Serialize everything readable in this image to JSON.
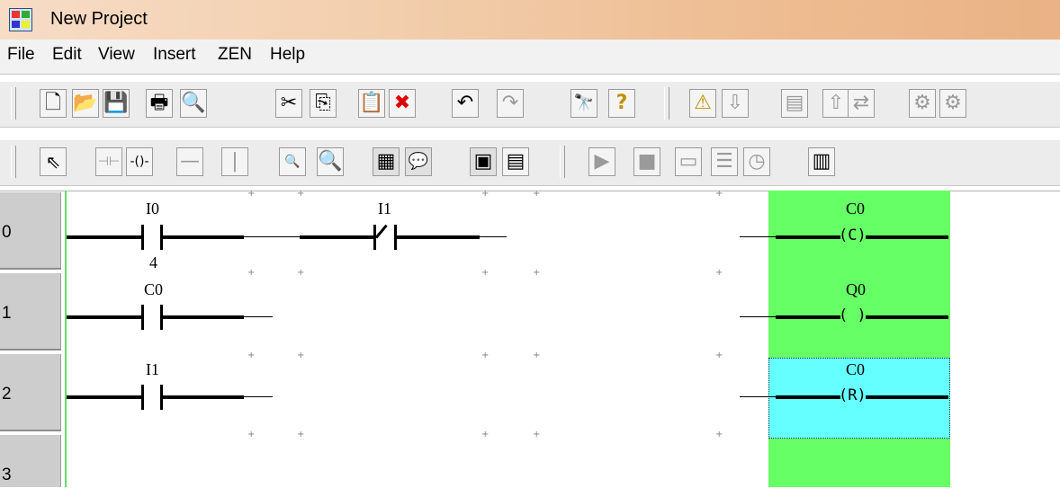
{
  "window": {
    "title": "New Project"
  },
  "menu": {
    "items": [
      "File",
      "Edit",
      "View",
      "Insert",
      "ZEN",
      "Help"
    ]
  },
  "toolbar1": {
    "buttons": [
      {
        "name": "new-file-icon",
        "glyph": "🗋"
      },
      {
        "name": "open-folder-icon",
        "glyph": "📂"
      },
      {
        "name": "save-icon",
        "glyph": "💾"
      },
      {
        "name": "print-icon",
        "glyph": "🖶"
      },
      {
        "name": "print-preview-icon",
        "glyph": "🔍"
      },
      {
        "name": "cut-icon",
        "glyph": "✂"
      },
      {
        "name": "copy-icon",
        "glyph": "⎘"
      },
      {
        "name": "paste-icon",
        "glyph": "📋"
      },
      {
        "name": "delete-icon",
        "glyph": "✖"
      },
      {
        "name": "undo-icon",
        "glyph": "↶"
      },
      {
        "name": "redo-icon",
        "glyph": "↷"
      },
      {
        "name": "find-icon",
        "glyph": "🔭"
      },
      {
        "name": "help-icon",
        "glyph": "?"
      },
      {
        "name": "warning-icon",
        "glyph": "⚠"
      },
      {
        "name": "transfer-icon",
        "glyph": "⇩"
      },
      {
        "name": "program-icon",
        "glyph": "▤"
      },
      {
        "name": "upload-icon",
        "glyph": "⇧"
      },
      {
        "name": "compare-icon",
        "glyph": "⇄"
      },
      {
        "name": "connect-icon",
        "glyph": "⚙"
      },
      {
        "name": "disconnect-icon",
        "glyph": "⚙"
      }
    ]
  },
  "toolbar2": {
    "buttons": [
      {
        "name": "select-pointer-icon",
        "glyph": "⇖"
      },
      {
        "name": "contact-icon",
        "glyph": "⊣⊢"
      },
      {
        "name": "coil-icon",
        "glyph": "-()-"
      },
      {
        "name": "horizontal-line-icon",
        "glyph": "—"
      },
      {
        "name": "vertical-line-icon",
        "glyph": "|"
      },
      {
        "name": "zoom-out-icon",
        "glyph": "🔍"
      },
      {
        "name": "zoom-in-icon",
        "glyph": "🔍"
      },
      {
        "name": "grid-icon",
        "glyph": "▦"
      },
      {
        "name": "comment-icon",
        "glyph": "💬"
      },
      {
        "name": "ladder-view-icon",
        "glyph": "▣"
      },
      {
        "name": "mnemonic-view-icon",
        "glyph": "▤"
      },
      {
        "name": "run-icon",
        "glyph": "▶"
      },
      {
        "name": "stop-icon",
        "glyph": "■"
      },
      {
        "name": "monitor-icon",
        "glyph": "▭"
      },
      {
        "name": "list-icon",
        "glyph": "☰"
      },
      {
        "name": "clock-icon",
        "glyph": "◷"
      },
      {
        "name": "simulator-icon",
        "glyph": "▥"
      }
    ]
  },
  "ladder": {
    "rows": [
      "0",
      "1",
      "2",
      "3"
    ],
    "rung0": {
      "contact1": "I0",
      "contact2": "I1",
      "coil": "C0",
      "coil_symbol": "(C)",
      "preset": "4"
    },
    "rung1": {
      "contact1": "C0",
      "coil": "Q0",
      "coil_symbol": "( )"
    },
    "rung2": {
      "contact1": "I1",
      "coil": "C0",
      "coil_symbol": "(R)"
    }
  },
  "colors": {
    "output_column": "#66ff66",
    "selected_cell": "#66ffff",
    "title_gradient_start": "#f7dcc6",
    "title_gradient_end": "#eab285"
  }
}
